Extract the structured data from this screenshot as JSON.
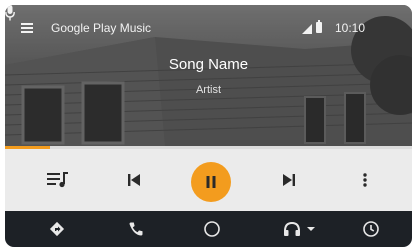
{
  "status_bar": {
    "app_title": "Google Play Music",
    "time": "10:10",
    "icons": [
      "menu-icon",
      "signal-icon",
      "battery-icon",
      "microphone-icon"
    ]
  },
  "now_playing": {
    "song_title": "Song Name",
    "artist": "Artist",
    "progress": 0.11,
    "accent_color": "#f39c1e"
  },
  "controls": {
    "icons": [
      "queue-icon",
      "skip-previous-icon",
      "pause-icon",
      "skip-next-icon",
      "more-vert-icon"
    ]
  },
  "navigation": {
    "icons": [
      "navigation-icon",
      "phone-icon",
      "home-icon",
      "headphones-icon",
      "recents-icon"
    ]
  }
}
